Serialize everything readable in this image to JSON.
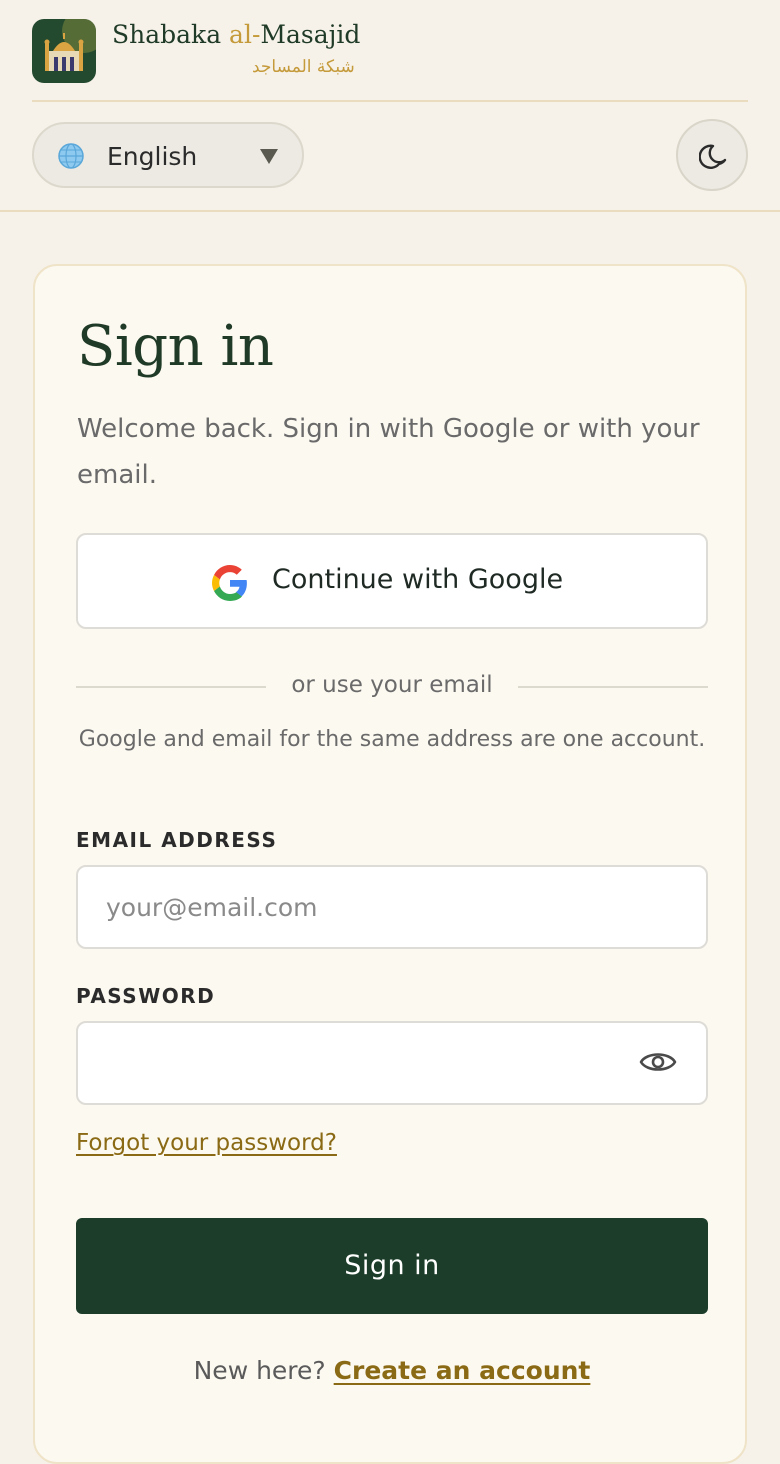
{
  "brand": {
    "name_prefix": "Shabaka ",
    "name_accent": "al-",
    "name_suffix": "Masajid",
    "name_arabic": "شبكة المساجد",
    "logo_icon": "mosque-icon"
  },
  "toolbar": {
    "language": {
      "icon": "globe-icon",
      "selected": "English"
    },
    "theme_toggle_icon": "moon-icon"
  },
  "signin": {
    "title": "Sign in",
    "subtitle": "Welcome back. Sign in with Google or with your email.",
    "google_button": "Continue with Google",
    "divider_text": "or use your email",
    "account_note": "Google and email for the same address are one account.",
    "email_label": "EMAIL ADDRESS",
    "email_placeholder": "your@email.com",
    "email_value": "",
    "password_label": "PASSWORD",
    "password_value": "",
    "forgot_link": "Forgot your password?",
    "submit_button": "Sign in",
    "footer_prompt": "New here?",
    "create_account_link": "Create an account"
  },
  "colors": {
    "background": "#f6f2ea",
    "primary": "#1c3d29",
    "accent_gold": "#c59a3a",
    "link": "#8a6a14"
  }
}
